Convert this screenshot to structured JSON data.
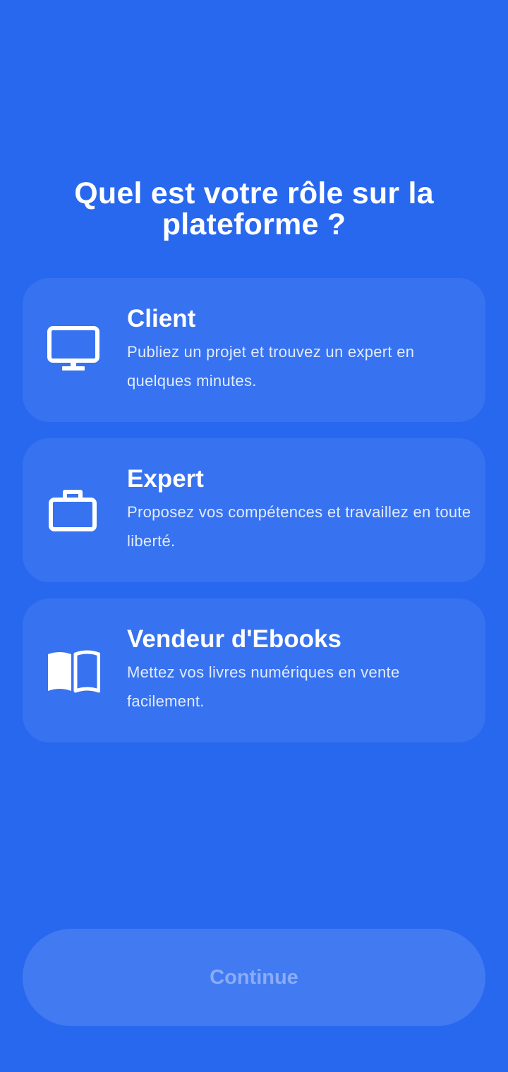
{
  "header": {
    "title": "Quel est votre rôle sur la plateforme ?"
  },
  "roles": [
    {
      "id": "client",
      "icon": "monitor-icon",
      "title": "Client",
      "description": "Publiez un projet et trouvez un expert en quelques minutes."
    },
    {
      "id": "expert",
      "icon": "briefcase-icon",
      "title": "Expert",
      "description": "Proposez vos compétences et travaillez en toute liberté."
    },
    {
      "id": "ebook-seller",
      "icon": "book-open-icon",
      "title": "Vendeur d'Ebooks",
      "description": "Mettez vos livres numériques en vente facilement."
    }
  ],
  "footer": {
    "continue_label": "Continue",
    "continue_enabled": false
  },
  "colors": {
    "background": "#2868EF",
    "text": "#FFFFFF"
  }
}
